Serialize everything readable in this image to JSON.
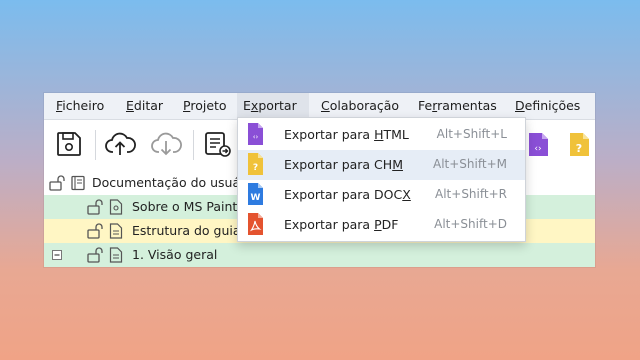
{
  "menubar": {
    "items": [
      {
        "pre": "",
        "u": "F",
        "post": "icheiro"
      },
      {
        "pre": "",
        "u": "E",
        "post": "ditar"
      },
      {
        "pre": "",
        "u": "P",
        "post": "rojeto"
      },
      {
        "pre": "E",
        "u": "x",
        "post": "portar"
      },
      {
        "pre": "",
        "u": "C",
        "post": "olaboração"
      },
      {
        "pre": "Fe",
        "u": "r",
        "post": "ramentas"
      },
      {
        "pre": "",
        "u": "D",
        "post": "efinições"
      }
    ]
  },
  "toolbar": {
    "icons": [
      "save-icon",
      "cloud-upload-icon",
      "cloud-download-icon",
      "export-document-icon",
      "html-file-icon",
      "chm-file-icon"
    ]
  },
  "tree": {
    "root_label": "Documentação do usuário",
    "rows": [
      {
        "label": "Sobre o MS Paint",
        "color": "#d4f0dc"
      },
      {
        "label": "Estrutura do guia",
        "color": "#fff6c4"
      },
      {
        "label": "1. Visão geral",
        "color": "#d4f0dc"
      }
    ],
    "collapse_symbol": "⊟"
  },
  "export_menu": {
    "items": [
      {
        "pre": "Exportar para ",
        "u": "H",
        "post": "TML",
        "shortcut": "Alt+Shift+L",
        "icon": "html-file-icon",
        "color": "#8a4fd6",
        "glyph": "‹›"
      },
      {
        "pre": "Exportar para CH",
        "u": "M",
        "post": "",
        "shortcut": "Alt+Shift+M",
        "icon": "chm-file-icon",
        "color": "#f0c23a",
        "glyph": "?"
      },
      {
        "pre": "Exportar para DOC",
        "u": "X",
        "post": "",
        "shortcut": "Alt+Shift+R",
        "icon": "docx-file-icon",
        "color": "#2e7be0",
        "glyph": "W"
      },
      {
        "pre": "Exportar para ",
        "u": "P",
        "post": "DF",
        "shortcut": "Alt+Shift+D",
        "icon": "pdf-file-icon",
        "color": "#e4532f",
        "glyph": "⅄"
      }
    ]
  }
}
